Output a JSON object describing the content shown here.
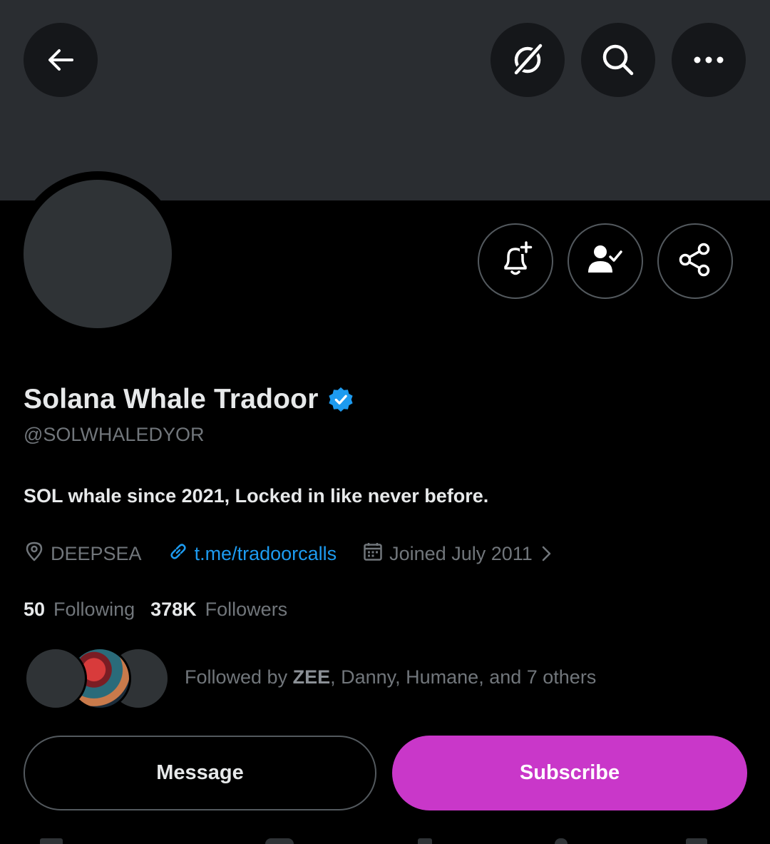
{
  "header": {
    "back_icon": "arrow-left-icon",
    "grok_icon": "grok-icon",
    "search_icon": "search-icon",
    "more_icon": "more-horizontal-icon",
    "banner_color": "#2a2d31"
  },
  "profile_actions": {
    "notify_icon": "bell-plus-icon",
    "following_icon": "person-check-icon",
    "share_icon": "share-icon"
  },
  "profile": {
    "display_name": "Solana Whale Tradoor",
    "verified_icon": "verified-badge-icon",
    "handle": "@SOLWHALEDYOR",
    "bio": "SOL whale since 2021, Locked in like never before.",
    "location": "DEEPSEA",
    "link": "t.me/tradoorcalls",
    "joined": "Joined July 2011"
  },
  "stats": {
    "following_count": "50",
    "following_label": "Following",
    "followers_count": "378K",
    "followers_label": "Followers"
  },
  "followed_by": {
    "prefix": "Followed by ",
    "highlight": "ZEE",
    "rest": ", Danny, Humane, and 7 others"
  },
  "buttons": {
    "message_label": "Message",
    "subscribe_label": "Subscribe"
  },
  "colors": {
    "accent_link": "#1d9bf0",
    "subscribe_bg": "#c937c9",
    "verified_badge": "#1d9bf0",
    "muted_text": "#71767b"
  }
}
